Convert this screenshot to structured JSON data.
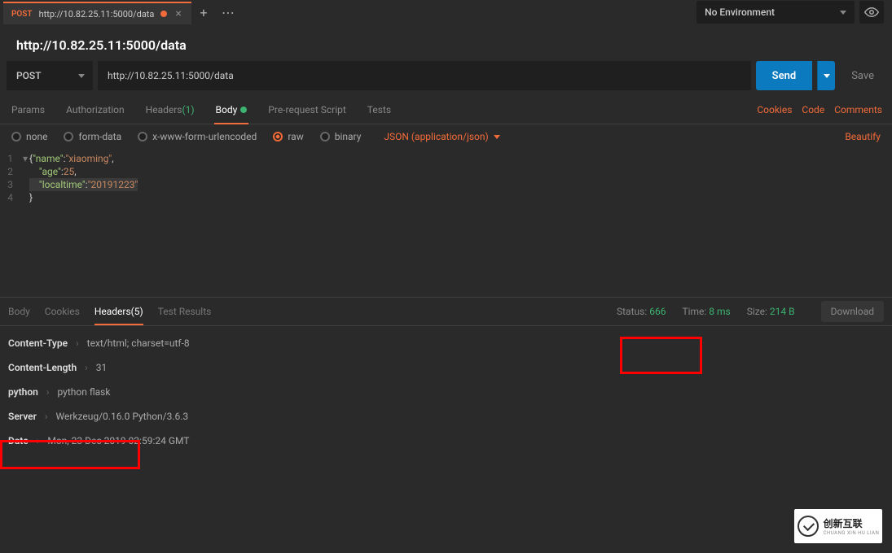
{
  "environment": {
    "label": "No Environment"
  },
  "tab": {
    "method": "POST",
    "title": "http://10.82.25.11:5000/data"
  },
  "request": {
    "title": "http://10.82.25.11:5000/data",
    "method": "POST",
    "url": "http://10.82.25.11:5000/data",
    "send_label": "Send",
    "save_label": "Save"
  },
  "request_tabs": {
    "params": "Params",
    "authorization": "Authorization",
    "headers": "Headers",
    "headers_count": "(1)",
    "body": "Body",
    "prerequest": "Pre-request Script",
    "tests": "Tests",
    "cookies": "Cookies",
    "code": "Code",
    "comments": "Comments"
  },
  "body_options": {
    "none": "none",
    "form_data": "form-data",
    "urlencoded": "x-www-form-urlencoded",
    "raw": "raw",
    "binary": "binary",
    "content_type": "JSON (application/json)",
    "beautify": "Beautify"
  },
  "editor_lines": [
    {
      "n": "1",
      "html": "<span class='tok-brace'>{</span><span class='tok-key'>\"name\"</span><span class='tok-brace'>:</span><span class='tok-str'>\"xiaoming\"</span><span class='tok-brace'>,</span>"
    },
    {
      "n": "2",
      "html": "    <span class='tok-key'>\"age\"</span><span class='tok-brace'>:</span><span class='tok-num'>25</span><span class='tok-brace'>,</span>"
    },
    {
      "n": "3",
      "html": "    <span class='tok-key'>\"localtime\"</span><span class='tok-brace'>:</span><span class='tok-str'>\"20191223\"</span>"
    },
    {
      "n": "4",
      "html": "<span class='tok-brace'>}</span>"
    }
  ],
  "response_tabs": {
    "body": "Body",
    "cookies": "Cookies",
    "headers": "Headers",
    "headers_count": "(5)",
    "test_results": "Test Results"
  },
  "response_stats": {
    "status_label": "Status:",
    "status_value": "666",
    "time_label": "Time:",
    "time_value": "8 ms",
    "size_label": "Size:",
    "size_value": "214 B",
    "download": "Download"
  },
  "response_headers": [
    {
      "key": "Content-Type",
      "value": "text/html; charset=utf-8"
    },
    {
      "key": "Content-Length",
      "value": "31"
    },
    {
      "key": "python",
      "value": "python flask"
    },
    {
      "key": "Server",
      "value": "Werkzeug/0.16.0 Python/3.6.3"
    },
    {
      "key": "Date",
      "value": "Mon, 23 Dec 2019 02:59:24 GMT"
    }
  ],
  "logo": {
    "main": "创新互联",
    "sub": "CHUANG XIN HU LIAN"
  }
}
